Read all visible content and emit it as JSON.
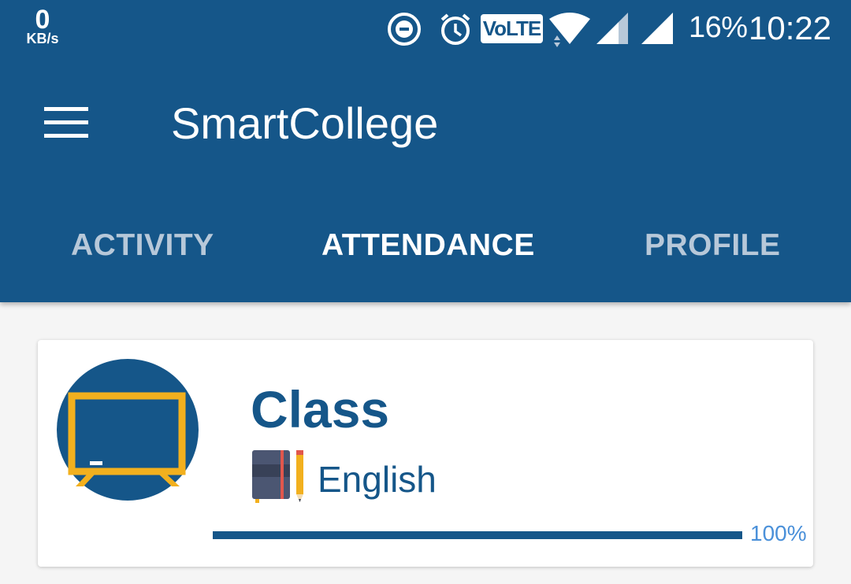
{
  "status_bar": {
    "net_speed_value": "0",
    "net_speed_unit": "KB/s",
    "network_type": "VoLTE",
    "battery": "16%",
    "time": "10:22",
    "icons": [
      "dnd-icon",
      "alarm-icon",
      "volte-icon",
      "wifi-icon",
      "signal-icon",
      "signal-icon"
    ]
  },
  "app_bar": {
    "title": "SmartCollege",
    "menu_icon": "hamburger-menu-icon"
  },
  "tabs": [
    {
      "label": "ACTIVITY",
      "active": false
    },
    {
      "label": "ATTENDANCE",
      "active": true
    },
    {
      "label": "PROFILE",
      "active": false
    }
  ],
  "card": {
    "icon": "chalkboard-icon",
    "title": "Class",
    "subject_icon": "notebook-pencil-icon",
    "subject": "English",
    "progress": 100,
    "progress_label": "100%"
  },
  "colors": {
    "primary": "#155689",
    "accent": "#4a90d9",
    "board_frame": "#f2b01e",
    "background": "#f5f5f5"
  }
}
